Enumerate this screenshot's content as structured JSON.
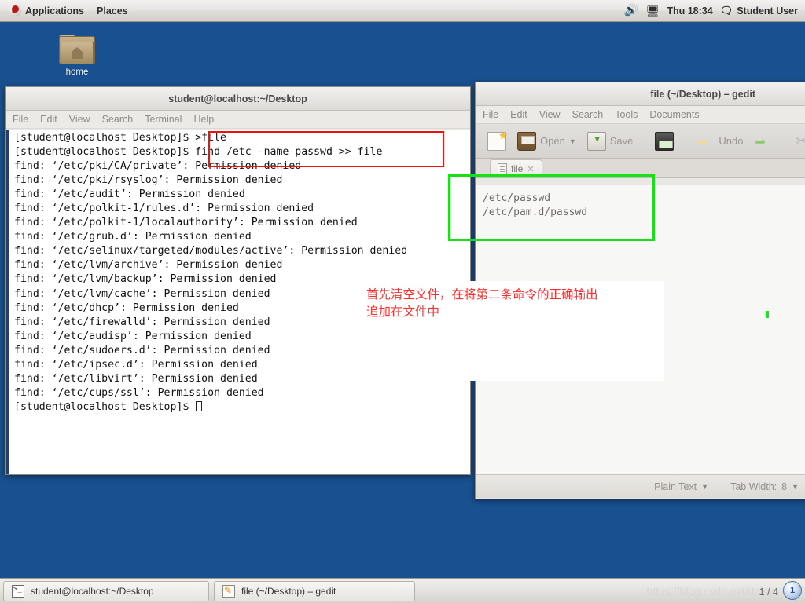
{
  "top_panel": {
    "applications_label": "Applications",
    "places_label": "Places",
    "volume_icon": "speaker-icon",
    "display_icon": "monitor-icon",
    "clock": "Thu 18:34",
    "user_icon": "chat-icon",
    "user_label": "Student User"
  },
  "desktop": {
    "icons": [
      {
        "name": "home-folder-icon",
        "label": "home"
      }
    ]
  },
  "terminal": {
    "title": "student@localhost:~/Desktop",
    "menu": [
      "File",
      "Edit",
      "View",
      "Search",
      "Terminal",
      "Help"
    ],
    "lines": [
      "[student@localhost Desktop]$ >file",
      "[student@localhost Desktop]$ find /etc -name passwd >> file",
      "find: ‘/etc/pki/CA/private’: Permission denied",
      "find: ‘/etc/pki/rsyslog’: Permission denied",
      "find: ‘/etc/audit’: Permission denied",
      "find: ‘/etc/polkit-1/rules.d’: Permission denied",
      "find: ‘/etc/polkit-1/localauthority’: Permission denied",
      "find: ‘/etc/grub.d’: Permission denied",
      "find: ‘/etc/selinux/targeted/modules/active’: Permission denied",
      "find: ‘/etc/lvm/archive’: Permission denied",
      "find: ‘/etc/lvm/backup’: Permission denied",
      "find: ‘/etc/lvm/cache’: Permission denied",
      "find: ‘/etc/dhcp’: Permission denied",
      "find: ‘/etc/firewalld’: Permission denied",
      "find: ‘/etc/audisp’: Permission denied",
      "find: ‘/etc/sudoers.d’: Permission denied",
      "find: ‘/etc/ipsec.d’: Permission denied",
      "find: ‘/etc/libvirt’: Permission denied",
      "find: ‘/etc/cups/ssl’: Permission denied"
    ],
    "prompt": "[student@localhost Desktop]$ "
  },
  "gedit": {
    "title": "file (~/Desktop) – gedit",
    "menu": [
      "File",
      "Edit",
      "View",
      "Search",
      "Tools",
      "Documents"
    ],
    "toolbar": {
      "new_icon": "new-document-icon",
      "open_label": "Open",
      "open_icon": "open-folder-icon",
      "open_chevron": "chevron-down-icon",
      "save_label": "Save",
      "save_icon": "save-disk-icon",
      "print_icon": "printer-icon",
      "undo_label": "Undo",
      "undo_icon": "undo-arrow-icon",
      "redo_icon": "redo-arrow-icon",
      "cut_icon": "scissors-icon"
    },
    "tab": {
      "label": "file",
      "doc_icon": "document-icon",
      "close_icon": "close-icon"
    },
    "document_text": "/etc/passwd\n/etc/pam.d/passwd",
    "statusbar": {
      "language": "Plain Text",
      "language_chevron": "chevron-down-icon",
      "tab_width_label": "Tab Width:",
      "tab_width_value": "8",
      "tab_width_chevron": "chevron-down-icon"
    }
  },
  "annotations": {
    "red_box_color": "#e8140d",
    "green_box_color": "#14e214",
    "note_color": "#ff2f2f",
    "note_text": "首先清空文件，在将第二条命令的正确输出\n追加在文件中"
  },
  "bottom_panel": {
    "tasks": [
      {
        "icon": "terminal-icon",
        "label": "student@localhost:~/Desktop"
      },
      {
        "icon": "gedit-icon",
        "label": "file (~/Desktop) – gedit"
      }
    ],
    "watermark": "https://blog.csdn.net/daisy…ng",
    "page_count": "1 / 4",
    "workspace_badge": "1"
  }
}
